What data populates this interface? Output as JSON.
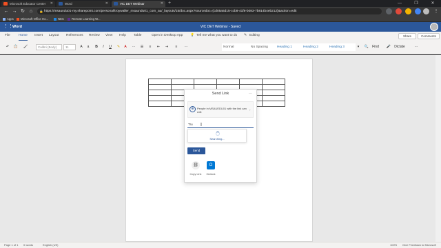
{
  "browser": {
    "tabs": [
      {
        "label": "Microsoft Educator Center",
        "icon_color": "#f25022"
      },
      {
        "label": "Word",
        "icon_color": "#2b579a"
      },
      {
        "label": "VIC DET Webinar",
        "icon_color": "#2b579a"
      }
    ],
    "url": "https://msaundu01-my.sharepoint.com/personal/troywaller_msaundu01_com_au/_layouts/15/doc.aspx?sourcedoc={cd05a5d15-ccb8-41f8-b083-7b814b4eb212}&action=edit",
    "bookmarks": [
      {
        "label": "Apps",
        "color": "#8ab4f8"
      },
      {
        "label": "Microsoft Office Ho...",
        "color": "#f25022"
      },
      {
        "label": "NEC",
        "color": "#1e88e5"
      },
      {
        "label": "Remote Learning W...",
        "color": "#5c2d91"
      }
    ]
  },
  "word": {
    "app_name": "Word",
    "doc_title": "VIC DET Webinar - Saved",
    "menu": [
      "File",
      "Home",
      "Insert",
      "Layout",
      "References",
      "Review",
      "View",
      "Help",
      "Table",
      "Open in Desktop App",
      "Tell me what you want to do",
      "Editing"
    ],
    "share_label": "Share",
    "comments_label": "Comments",
    "ribbon": {
      "font_name": "Calibri (Body)",
      "font_size": "11",
      "styles": [
        "Normal",
        "No Spacing",
        "Heading 1",
        "Heading 2",
        "Heading 3"
      ],
      "find_label": "Find",
      "dictate_label": "Dictate"
    }
  },
  "dialog": {
    "title": "Send Link",
    "more": "...",
    "permission_text": "People in MSAUEDU01 with the link can edit",
    "to_value": "Tru",
    "searching_label": "Searching...",
    "send_label": "Send",
    "options": [
      {
        "label": "Copy Link",
        "icon": "link-icon"
      },
      {
        "label": "Outlook",
        "icon": "outlook-icon"
      }
    ]
  },
  "status": {
    "page": "Page 1 of 1",
    "words": "0 words",
    "language": "English (US)",
    "zoom": "100%",
    "feedback": "Give Feedback to Microsoft"
  }
}
